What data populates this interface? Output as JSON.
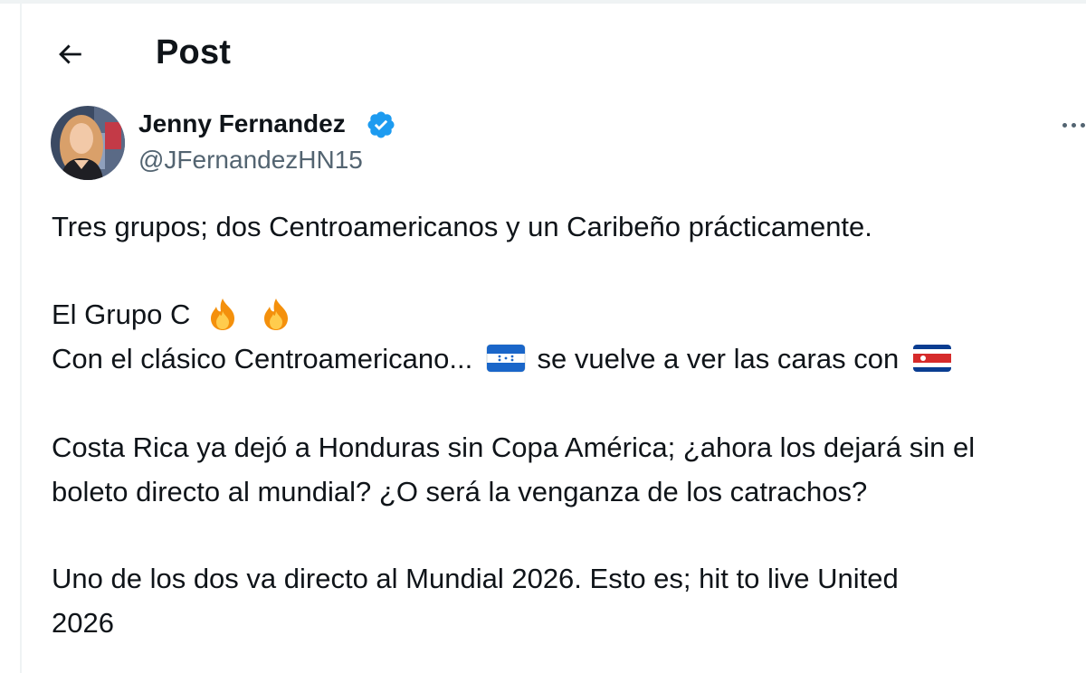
{
  "header": {
    "back_icon": "arrow-left-icon",
    "title": "Post"
  },
  "author": {
    "name": "Jenny Fernandez",
    "handle": "@JFernandezHN15",
    "verified_icon": "verified-badge-icon",
    "verified_color": "#1d9bf0",
    "more_icon": "more-horizontal-icon"
  },
  "tweet": {
    "line1": "Tres grupos; dos Centroamericanos y un Caribeño prácticamente.",
    "line2_text": "El Grupo C",
    "line2_emojis": [
      "fire-emoji",
      "fire-emoji"
    ],
    "line3_part1": "Con el clásico Centroamericano...",
    "line3_flag1": "honduras-flag-emoji",
    "line3_part2": "se vuelve a ver las caras con",
    "line3_flag2": "costa-rica-flag-emoji",
    "line4": "Costa Rica ya dejó a Honduras sin Copa América; ¿ahora los dejará sin el",
    "line5": "boleto directo al mundial? ¿O será la venganza de los catrachos?",
    "line6": "Uno de los dos va directo al Mundial 2026. Esto es; hit to live United",
    "line7": "2026"
  },
  "colors": {
    "text_primary": "#0f1419",
    "text_secondary": "#536471",
    "border": "#eff3f4"
  }
}
